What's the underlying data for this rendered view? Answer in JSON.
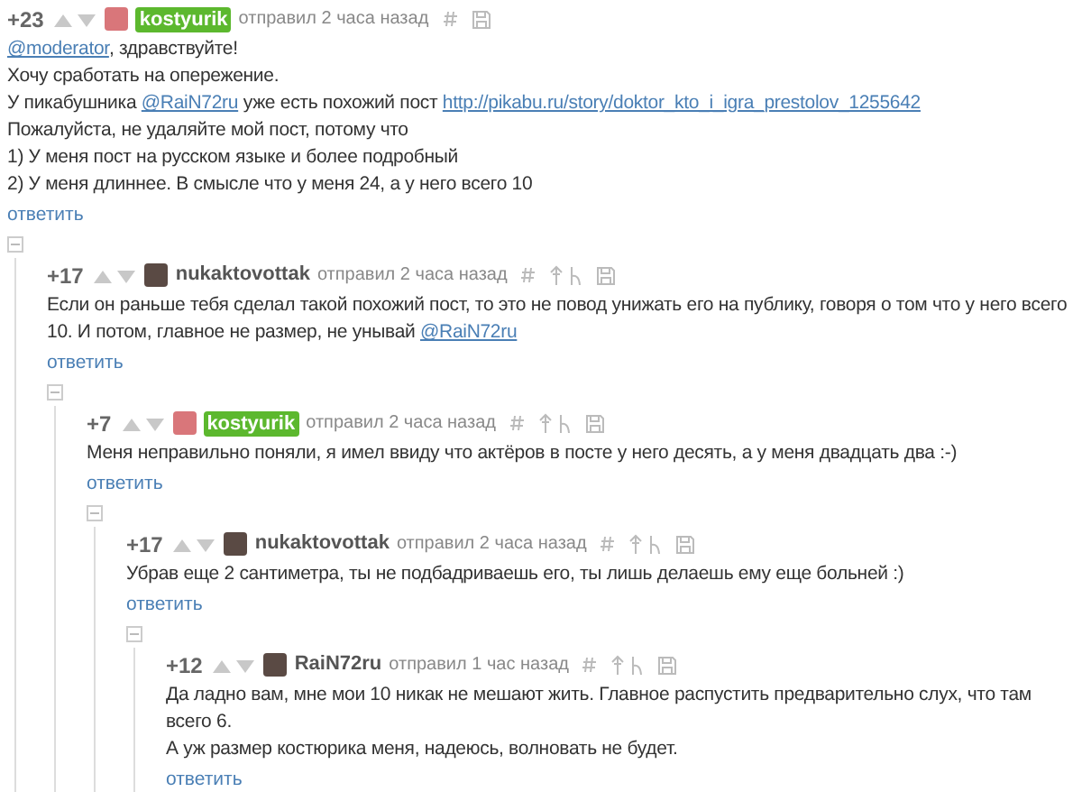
{
  "comments": [
    {
      "score": "+23",
      "author": "kostyurik",
      "author_highlighted": true,
      "meta": "отправил 2 часа назад",
      "parent_links": false,
      "reply": "ответить",
      "expanded": true,
      "body": [
        [
          {
            "kind": "mention",
            "text": "@moderator"
          },
          {
            "kind": "text",
            "text": ", здравствуйте!"
          }
        ],
        [
          {
            "kind": "text",
            "text": "Хочу сработать на опережение."
          }
        ],
        [
          {
            "kind": "text",
            "text": "У пикабушника "
          },
          {
            "kind": "mention",
            "text": "@RaiN72ru"
          },
          {
            "kind": "text",
            "text": " уже есть похожий пост  "
          },
          {
            "kind": "link",
            "text": "http://pikabu.ru/story/doktor_kto_i_igra_prestolov_1255642"
          }
        ],
        [
          {
            "kind": "text",
            "text": "Пожалуйста, не удаляйте мой пост, потому что"
          }
        ],
        [
          {
            "kind": "text",
            "text": "1) У меня пост на русском языке и более подробный"
          }
        ],
        [
          {
            "kind": "text",
            "text": "2) У меня длиннее. В смысле что у меня 24, а у него всего 10"
          }
        ]
      ],
      "children": [
        {
          "score": "+17",
          "author": "nukaktovottak",
          "author_highlighted": false,
          "meta": "отправил 2 часа назад",
          "parent_links": true,
          "reply": "ответить",
          "expanded": true,
          "body": [
            [
              {
                "kind": "text",
                "text": "Если он раньше тебя сделал такой похожий пост, то это не повод унижать его на публику, говоря о том что у него всего"
              }
            ],
            [
              {
                "kind": "text",
                "text": "10. И потом, главное не размер, не унывай "
              },
              {
                "kind": "mention",
                "text": "@RaiN72ru"
              }
            ]
          ],
          "children": [
            {
              "score": "+7",
              "author": "kostyurik",
              "author_highlighted": true,
              "meta": "отправил 2 часа назад",
              "parent_links": true,
              "reply": "ответить",
              "expanded": true,
              "body": [
                [
                  {
                    "kind": "text",
                    "text": "Меня неправильно поняли, я имел ввиду что актёров в посте у него десять, а у меня двадцать два :-)"
                  }
                ]
              ],
              "children": [
                {
                  "score": "+17",
                  "author": "nukaktovottak",
                  "author_highlighted": false,
                  "meta": "отправил 2 часа назад",
                  "parent_links": true,
                  "reply": "ответить",
                  "expanded": true,
                  "body": [
                    [
                      {
                        "kind": "text",
                        "text": "Убрав еще 2 сантиметра, ты не подбадриваешь его, ты лишь делаешь ему еще больней :)"
                      }
                    ]
                  ],
                  "children": [
                    {
                      "score": "+12",
                      "author": "RaiN72ru",
                      "author_highlighted": false,
                      "meta": "отправил 1 час назад",
                      "parent_links": true,
                      "reply": "ответить",
                      "body": [
                        [
                          {
                            "kind": "text",
                            "text": "Да ладно вам, мне мои 10 никак не мешают жить. Главное распустить предварительно слух, что там"
                          }
                        ],
                        [
                          {
                            "kind": "text",
                            "text": "всего 6."
                          }
                        ],
                        [
                          {
                            "kind": "text",
                            "text": "А уж размер костюрика меня, надеюсь, волновать не будет."
                          }
                        ]
                      ]
                    }
                  ]
                }
              ]
            }
          ]
        }
      ]
    }
  ]
}
